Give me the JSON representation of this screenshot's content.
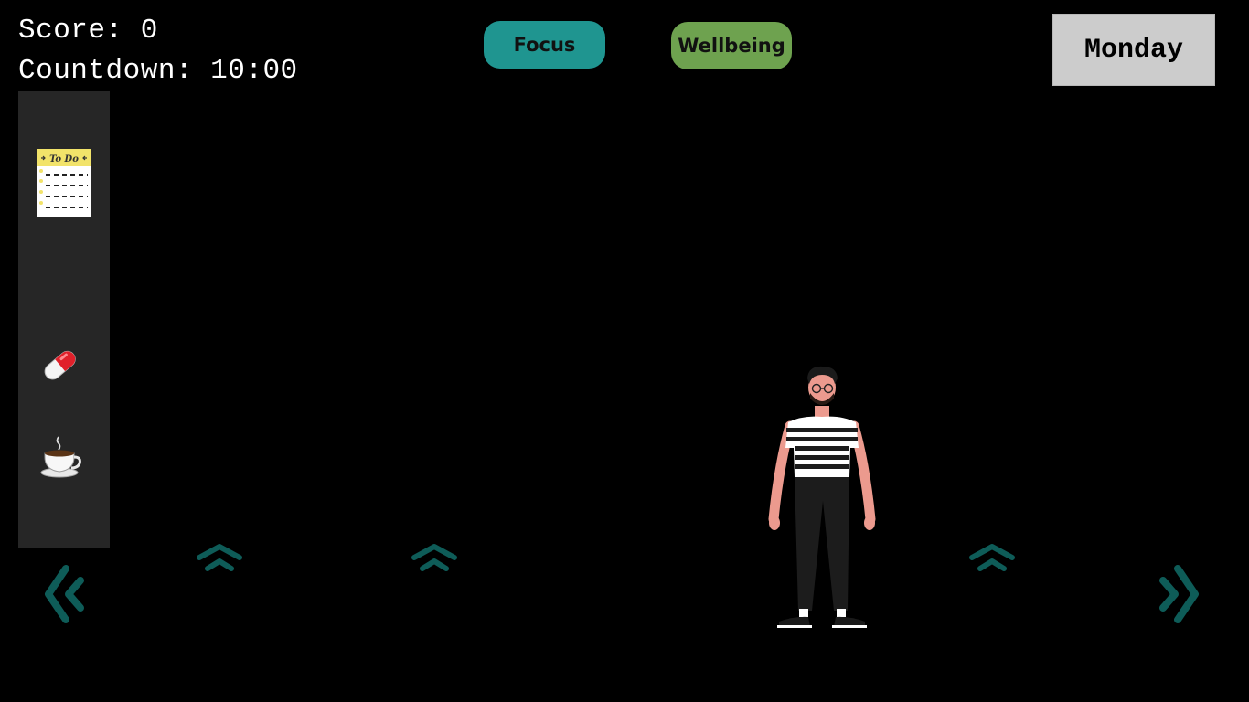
{
  "hud": {
    "score_text": "Score: 0",
    "countdown_text": "Countdown: 10:00"
  },
  "top_buttons": {
    "focus_label": "Focus",
    "wellbeing_label": "Wellbeing"
  },
  "day": {
    "label": "Monday"
  },
  "sidebar": {
    "items": [
      {
        "icon": "todo-list-icon",
        "title": "To Do"
      },
      {
        "icon": "pill-icon"
      },
      {
        "icon": "coffee-cup-icon"
      }
    ]
  },
  "navigation": {
    "left_icon": "double-chevron-left-icon",
    "right_icon": "double-chevron-right-icon",
    "up_icon": "double-chevron-up-icon"
  },
  "colors": {
    "background": "#000000",
    "focus": "#1f9590",
    "wellbeing": "#6ea24f",
    "day_box": "#cccccc",
    "sidebar": "#262626",
    "arrows": "#0e5c58"
  }
}
